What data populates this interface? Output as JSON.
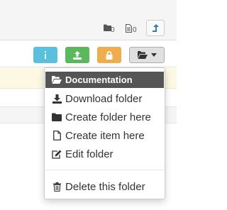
{
  "header": {
    "folder_count": "0",
    "file_count": "0"
  },
  "toolbar": {
    "colors": {
      "info": "#5bc0de",
      "success": "#5cb85c",
      "warning": "#f0ad4e",
      "default": "#e0e0e0"
    },
    "buttons": [
      "info-icon",
      "upload-icon",
      "lock-icon",
      "folder-open-icon"
    ]
  },
  "folder_menu": {
    "header": "Documentation",
    "items": [
      {
        "label": "Download folder",
        "icon": "download-icon"
      },
      {
        "label": "Create folder here",
        "icon": "folder-icon"
      },
      {
        "label": "Create item here",
        "icon": "file-icon"
      },
      {
        "label": "Edit folder",
        "icon": "edit-icon"
      },
      {
        "label": "Delete this folder",
        "icon": "trash-icon"
      }
    ]
  }
}
